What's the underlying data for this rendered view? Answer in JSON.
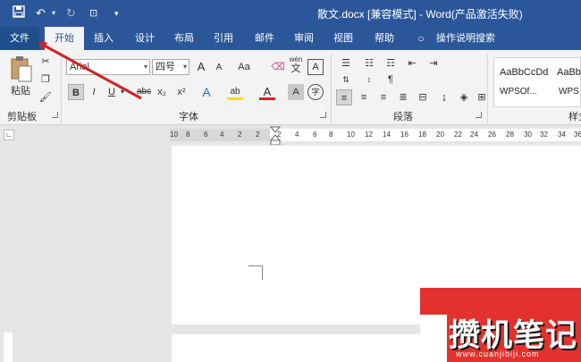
{
  "title_bar": {
    "document_title": "散文.docx [兼容模式]  -  Word(产品激活失败)"
  },
  "tabs": [
    {
      "label": "文件"
    },
    {
      "label": "开始"
    },
    {
      "label": "插入"
    },
    {
      "label": "设计"
    },
    {
      "label": "布局"
    },
    {
      "label": "引用"
    },
    {
      "label": "邮件"
    },
    {
      "label": "审阅"
    },
    {
      "label": "视图"
    },
    {
      "label": "帮助"
    }
  ],
  "tell_me": "操作说明搜索",
  "clipboard": {
    "paste_label": "粘贴",
    "group_label": "剪贴板"
  },
  "font": {
    "name": "Arial",
    "size": "四号",
    "group_label": "字体",
    "grow": "A",
    "shrink": "A",
    "case": "Aa",
    "bold": "B",
    "italic": "I",
    "underline": "U",
    "strike": "abc",
    "subscript": "x₂",
    "superscript": "x²",
    "phonetic": "wén",
    "phonetic_sub": "文",
    "circle": "字"
  },
  "paragraph": {
    "group_label": "段落"
  },
  "styles": {
    "items": [
      "AaBbCcDd",
      "AaBbC"
    ],
    "sub_items": [
      "WPSOf...",
      "WPS"
    ],
    "group_label": "样式"
  },
  "ruler": {
    "ticks": [
      "10",
      "8",
      "6",
      "4",
      "2",
      "2",
      "2",
      "4",
      "6",
      "8",
      "10",
      "12",
      "14",
      "16",
      "18",
      "20",
      "22",
      "24",
      "26",
      "28",
      "30",
      "32",
      "34",
      "36"
    ]
  },
  "watermark": {
    "text": "攒机笔记",
    "url": "www.cuanjibiji.com"
  },
  "colors": {
    "accent": "#2b579a",
    "watermark_red": "#e5312d",
    "annotation_arrow": "#d42020"
  }
}
